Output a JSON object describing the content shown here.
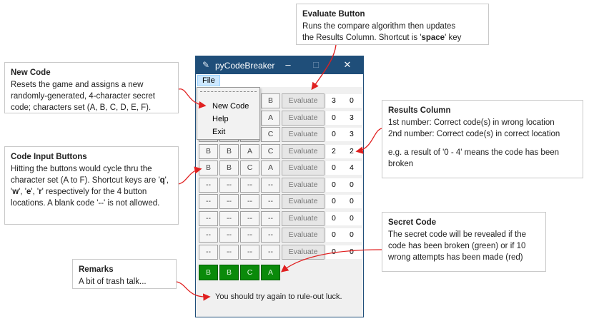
{
  "window": {
    "title": "pyCodeBreaker",
    "controls": {
      "minimize": "–",
      "maximize": "□",
      "close": "✕"
    },
    "icon": "feather-icon"
  },
  "menu": {
    "file_label": "File",
    "items": [
      "New Code",
      "Help",
      "Exit"
    ]
  },
  "evaluate_label": "Evaluate",
  "rows": [
    {
      "codes": [
        "",
        "",
        "",
        "B"
      ],
      "results": [
        "3",
        "0"
      ]
    },
    {
      "codes": [
        "",
        "",
        "",
        "A"
      ],
      "results": [
        "0",
        "3"
      ]
    },
    {
      "codes": [
        "",
        "",
        "",
        "C"
      ],
      "results": [
        "0",
        "3"
      ]
    },
    {
      "codes": [
        "B",
        "B",
        "A",
        "C"
      ],
      "results": [
        "2",
        "2"
      ]
    },
    {
      "codes": [
        "B",
        "B",
        "C",
        "A"
      ],
      "results": [
        "0",
        "4"
      ]
    },
    {
      "codes": [
        "--",
        "--",
        "--",
        "--"
      ],
      "results": [
        "0",
        "0"
      ]
    },
    {
      "codes": [
        "--",
        "--",
        "--",
        "--"
      ],
      "results": [
        "0",
        "0"
      ]
    },
    {
      "codes": [
        "--",
        "--",
        "--",
        "--"
      ],
      "results": [
        "0",
        "0"
      ]
    },
    {
      "codes": [
        "--",
        "--",
        "--",
        "--"
      ],
      "results": [
        "0",
        "0"
      ]
    },
    {
      "codes": [
        "--",
        "--",
        "--",
        "--"
      ],
      "results": [
        "0",
        "0"
      ]
    }
  ],
  "secret_code": [
    "B",
    "B",
    "C",
    "A"
  ],
  "remarks": "You should try again to rule-out luck.",
  "colors": {
    "titlebar": "#1f4e79",
    "secret_broken": "#0a8a0a",
    "arrow": "#e02020"
  },
  "callouts": {
    "evaluate": {
      "title": "Evaluate Button",
      "line1": "Runs the compare algorithm then updates",
      "line2_pre": "the Results Column. Shortcut is '",
      "line2_key": "space",
      "line2_post": "' key"
    },
    "new_code": {
      "title": "New Code",
      "text": "Resets the game and assigns a new randomly-generated, 4-character secret code; characters set (A, B, C, D, E, F)."
    },
    "results": {
      "title": "Results Column",
      "line1": "1st number: Correct code(s) in wrong location",
      "line2": "2nd number: Correct code(s) in correct location",
      "line3": "e.g. a result of '0 - 4' means the code has been broken"
    },
    "code_input": {
      "title": "Code Input Buttons",
      "text_pre": "Hitting the buttons would cycle thru the character set (A to F). Shortcut keys are '",
      "k1": "q",
      "sep1": "', '",
      "k2": "w",
      "sep2": "', '",
      "k3": "e",
      "sep3": "', '",
      "k4": "r",
      "text_post": "' respectively for the 4 button locations. A blank code '--' is not allowed."
    },
    "secret": {
      "title": "Secret Code",
      "text": "The secret code will be revealed if the code has been broken (green) or if 10 wrong attempts has been made (red)"
    },
    "remarks": {
      "title": "Remarks",
      "text": "A bit of trash talk..."
    }
  }
}
